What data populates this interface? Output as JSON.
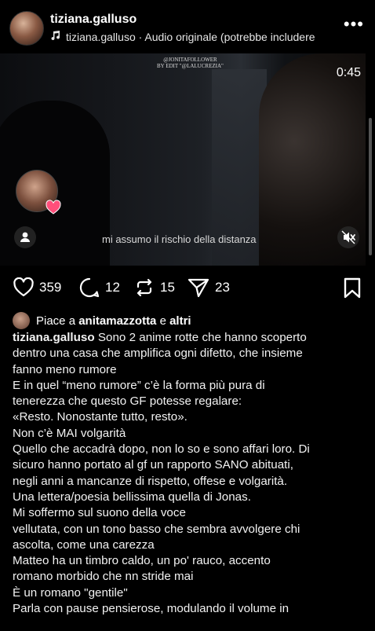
{
  "header": {
    "username": "tiziana.galluso",
    "audio": "tiziana.galluso · Audio originale  (potrebbe includere",
    "more_icon": "ellipsis-icon"
  },
  "video": {
    "watermark_line1": "@JONITAFOLLOWER",
    "watermark_line2": "BY EDIT \"@LALUCREZIA\"",
    "time": "0:45",
    "subtitle": "mi assumo il rischio della distanza"
  },
  "actions": {
    "likes": "359",
    "comments": "12",
    "reposts": "15",
    "shares": "23"
  },
  "liked_by": {
    "prefix": "Piace a",
    "user": "anitamazzotta",
    "conj": "e",
    "others": "altri"
  },
  "post": {
    "author": "tiziana.galluso",
    "lines": [
      "Sono 2 anime rotte che hanno scoperto",
      "dentro una casa che amplifica ogni difetto, che insieme",
      "fanno meno rumore",
      "E in quel “meno rumore” c’è la forma più pura di",
      "tenerezza che questo GF potesse regalare:",
      "«Resto. Nonostante tutto, resto».",
      "Non c’è MAI volgarità",
      "Quello che accadrà dopo, non lo so e sono affari loro. Di",
      "sicuro hanno portato al gf un rapporto SANO abituati,",
      "negli anni a mancanze di rispetto, offese e volgarità.",
      "Una lettera/poesia bellissima quella di Jonas.",
      "Mi soffermo sul suono della voce",
      " vellutata, con un tono basso che sembra avvolgere chi",
      "ascolta, come una carezza",
      "Matteo ha un timbro caldo, un po' rauco, accento",
      "romano morbido che nn stride mai",
      "È un romano \"gentile\"",
      "Parla con pause pensierose, modulando il volume in"
    ]
  }
}
